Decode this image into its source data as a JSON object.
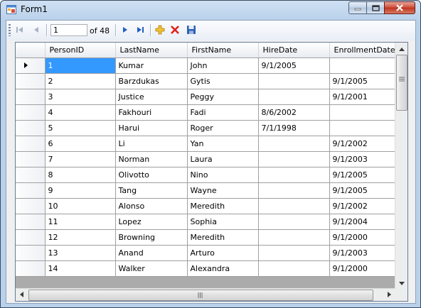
{
  "window": {
    "title": "Form1"
  },
  "navigator": {
    "position": "1",
    "count_label": "of 48"
  },
  "grid": {
    "columns": [
      "PersonID",
      "LastName",
      "FirstName",
      "HireDate",
      "EnrollmentDate"
    ],
    "rows": [
      [
        "1",
        "Kumar",
        "John",
        "9/1/2005",
        ""
      ],
      [
        "2",
        "Barzdukas",
        "Gytis",
        "",
        "9/1/2005"
      ],
      [
        "3",
        "Justice",
        "Peggy",
        "",
        "9/1/2001"
      ],
      [
        "4",
        "Fakhouri",
        "Fadi",
        "8/6/2002",
        ""
      ],
      [
        "5",
        "Harui",
        "Roger",
        "7/1/1998",
        ""
      ],
      [
        "6",
        "Li",
        "Yan",
        "",
        "9/1/2002"
      ],
      [
        "7",
        "Norman",
        "Laura",
        "",
        "9/1/2003"
      ],
      [
        "8",
        "Olivotto",
        "Nino",
        "",
        "9/1/2005"
      ],
      [
        "9",
        "Tang",
        "Wayne",
        "",
        "9/1/2005"
      ],
      [
        "10",
        "Alonso",
        "Meredith",
        "",
        "9/1/2002"
      ],
      [
        "11",
        "Lopez",
        "Sophia",
        "",
        "9/1/2004"
      ],
      [
        "12",
        "Browning",
        "Meredith",
        "",
        "9/1/2000"
      ],
      [
        "13",
        "Anand",
        "Arturo",
        "",
        "9/1/2003"
      ],
      [
        "14",
        "Walker",
        "Alexandra",
        "",
        "9/1/2000"
      ]
    ],
    "selected_row": 0
  },
  "icons": {
    "move_first": "move-first-icon",
    "move_previous": "move-previous-icon",
    "move_next": "move-next-icon",
    "move_last": "move-last-icon",
    "add_new": "add-new-icon",
    "delete": "delete-icon",
    "save": "save-icon"
  },
  "colors": {
    "selection": "#3399ff",
    "close_button": "#c0341f"
  }
}
